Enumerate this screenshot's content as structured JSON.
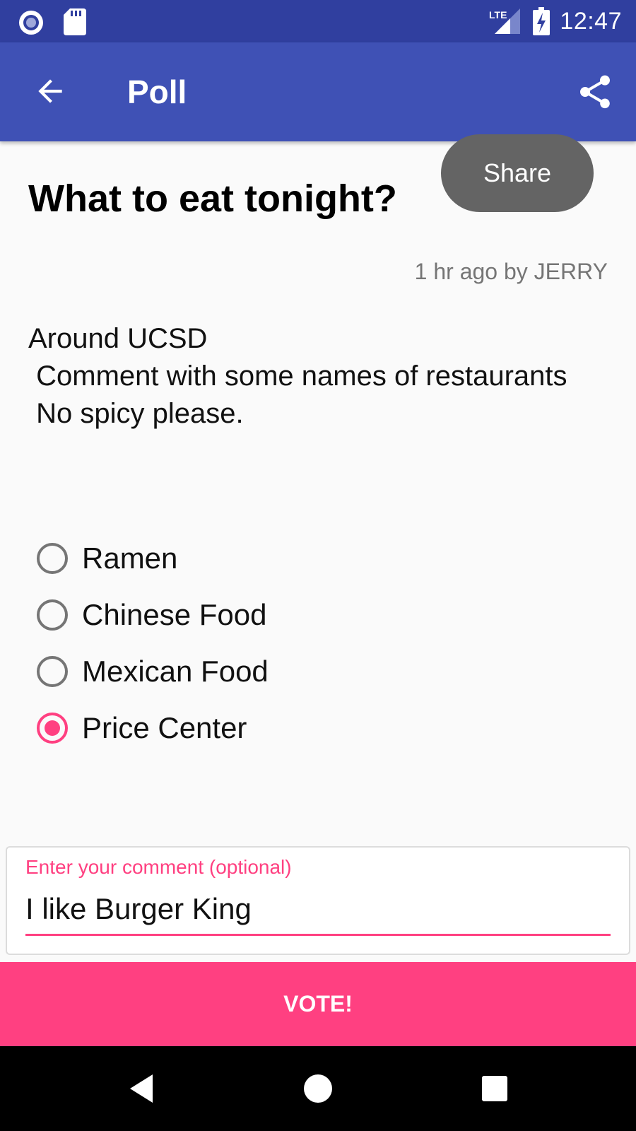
{
  "status_bar": {
    "time": "12:47",
    "network": "LTE",
    "icons": [
      "notification-circle-icon",
      "sd-card-icon",
      "lte-signal-icon",
      "battery-charging-icon"
    ]
  },
  "app_bar": {
    "title": "Poll",
    "back_icon": "arrow-back-icon",
    "share_icon": "share-icon"
  },
  "toast": {
    "text": "Share"
  },
  "poll": {
    "title": "What to eat tonight?",
    "meta": "1 hr ago by JERRY",
    "description": "Around UCSD\n Comment with some names of restaurants\n No spicy please.",
    "options": [
      {
        "label": "Ramen",
        "selected": false
      },
      {
        "label": "Chinese Food",
        "selected": false
      },
      {
        "label": "Mexican Food",
        "selected": false
      },
      {
        "label": "Price Center",
        "selected": true
      }
    ]
  },
  "comment": {
    "label": "Enter your comment (optional)",
    "value": "I like Burger King"
  },
  "vote_button": {
    "label": "VOTE!"
  },
  "nav_bar": {
    "icons": [
      "nav-back-icon",
      "nav-home-icon",
      "nav-recents-icon"
    ]
  },
  "colors": {
    "status_bar": "#303f9f",
    "app_bar": "#3f51b5",
    "accent": "#ff4081",
    "toast": "#646464",
    "background": "#fafafa"
  }
}
